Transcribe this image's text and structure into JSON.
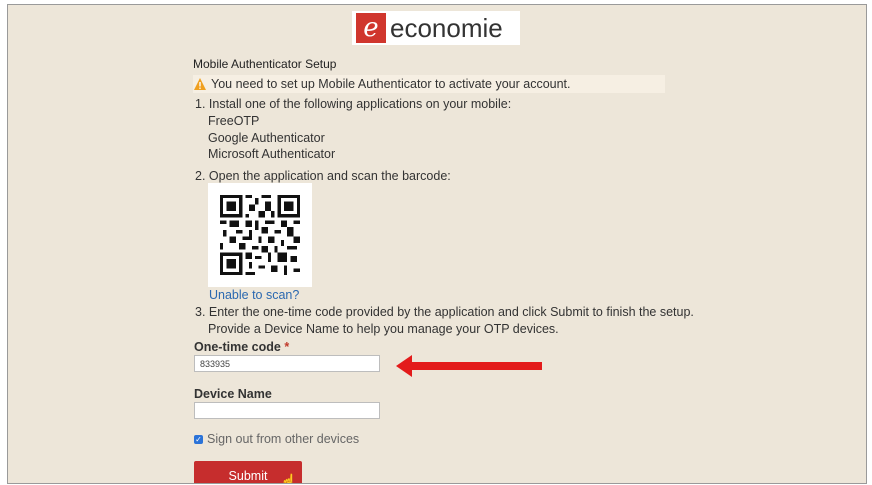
{
  "logo": {
    "mark": "e",
    "text": "economie"
  },
  "page": {
    "heading": "Mobile Authenticator Setup",
    "warning": "You need to set up Mobile Authenticator to activate your account."
  },
  "steps": {
    "step1": "1. Install one of the following applications on your mobile:",
    "apps": [
      "FreeOTP",
      "Google Authenticator",
      "Microsoft Authenticator"
    ],
    "step2": "2. Open the application and scan the barcode:",
    "unable_link": "Unable to scan?",
    "step3_line1": "3. Enter the one-time code provided by the application and click Submit to finish the setup.",
    "step3_line2": "Provide a Device Name to help you manage your OTP devices."
  },
  "form": {
    "otp_label": "One-time code",
    "otp_required": "*",
    "otp_value": "833935",
    "device_label": "Device Name",
    "device_value": "",
    "signout_label": "Sign out from other devices",
    "signout_checked": true,
    "submit_label": "Submit"
  },
  "colors": {
    "accent": "#c62d2d",
    "link": "#2a68b0",
    "arrow": "#e31b1b",
    "background": "#ede6d9"
  }
}
